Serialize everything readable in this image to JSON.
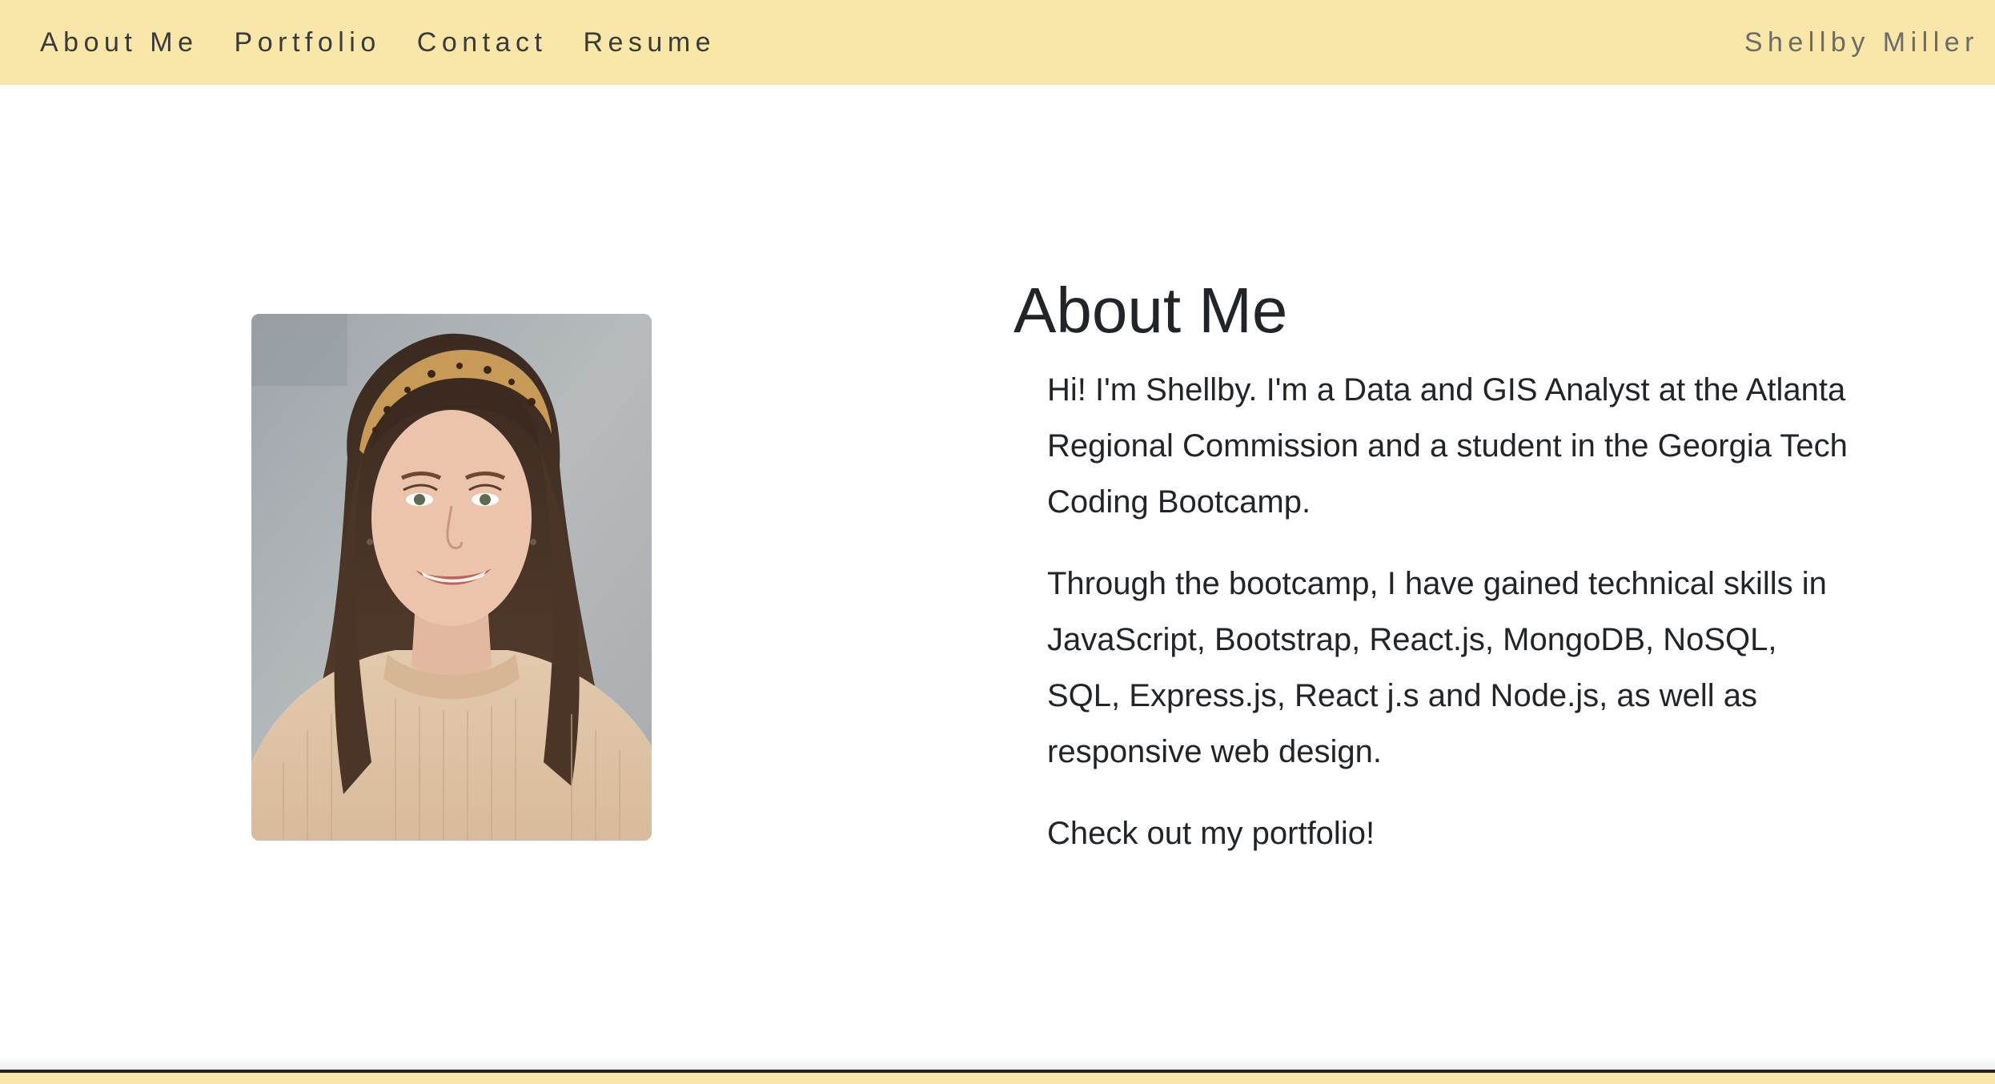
{
  "nav": {
    "links": [
      "About Me",
      "Portfolio",
      "Contact",
      "Resume"
    ],
    "brand": "Shellby Miller"
  },
  "about": {
    "title": "About Me",
    "paragraphs": [
      "Hi! I'm Shellby. I'm a Data and GIS Analyst at the Atlanta Regional Commission and a student in the Georgia Tech Coding Bootcamp.",
      "Through the bootcamp, I have gained technical skills in JavaScript, Bootstrap, React.js, MongoDB, NoSQL, SQL, Express.js, React j.s and Node.js, as well as responsive web design.",
      "Check out my portfolio!"
    ]
  },
  "colors": {
    "navbar_bg": "#f8e7a8",
    "text": "#212529",
    "brand_text": "#6b6b6b"
  }
}
